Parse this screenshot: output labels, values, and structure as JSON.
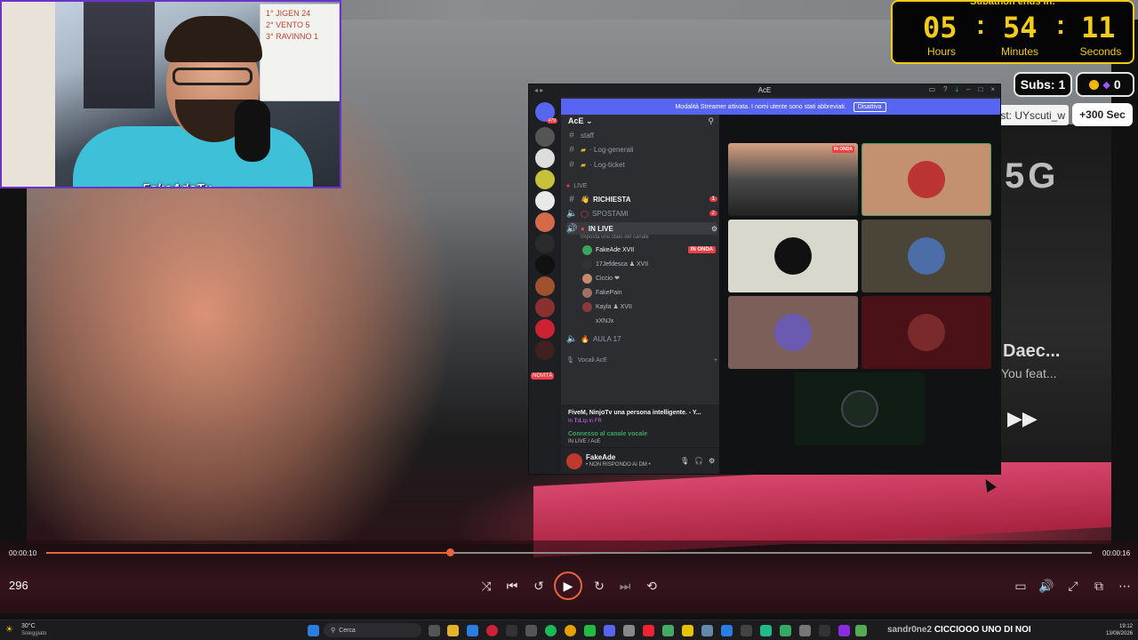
{
  "webcam": {
    "name_tag": "FakeAdeTv",
    "board_lines": [
      "1° JIGEN 24",
      "2° VENTO 5",
      "3° RAVINNO 1"
    ]
  },
  "timer": {
    "title": "Subathon ends in:",
    "hours": "05",
    "minutes": "54",
    "seconds": "11",
    "hours_label": "Hours",
    "minutes_label": "Minutes",
    "seconds_label": "Seconds"
  },
  "stats": {
    "subs": "Subs: 1",
    "bits": "0",
    "latest": "Latest: UYscuti_w",
    "time_add": "+300 Sec"
  },
  "discord": {
    "window_title": "AcE",
    "banner_text": "Modalità Streamer attivata. I nomi utente sono stati abbreviati.",
    "banner_button": "Disattiva",
    "server_name": "AcE",
    "server_badge_top": "479",
    "novita": "NOVITÀ",
    "channels": [
      {
        "name": "staff",
        "badge": ""
      },
      {
        "name": "· Log-generali",
        "badge": ""
      },
      {
        "name": "· Log-ticket",
        "badge": ""
      }
    ],
    "live_header": "LIVE",
    "live_channels": [
      {
        "name": "RICHIESTA",
        "badge": "1"
      },
      {
        "name": "SPOSTAMI",
        "badge": "2"
      }
    ],
    "voice_channel": "IN LIVE",
    "voice_channel_sub": "Imposta uno stato del canale",
    "users": [
      {
        "name": "FakeAde XVII",
        "tag": "IN ONDA"
      },
      {
        "name": "17Jefdesca ♟ XVII",
        "tag": ""
      },
      {
        "name": "Ciccio ❤",
        "tag": ""
      },
      {
        "name": "FakePain",
        "tag": ""
      },
      {
        "name": "Kayla ♟ XVII",
        "tag": ""
      },
      {
        "name": "xXNJx",
        "tag": ""
      }
    ],
    "aula": "AULA 17",
    "vocali_header": "Vocali AcE",
    "activity_title": "FiveM, NinjoTv una persona intelligente. - Y...",
    "activity_sub": "In 𝐓ɪ𝐋ɪp in FR",
    "voice_connected": "Connesso al canale vocale",
    "voice_connected_sub": "IN LIVE / AcE",
    "self_user": "FakeAde",
    "self_status": "• NON RISPONDO AI DM •",
    "in_onda_tag": "IN ONDA"
  },
  "player": {
    "current_time": "00:00:10",
    "total_time": "00:00:16",
    "progress": 0.386,
    "counter": "296"
  },
  "taskbar": {
    "weather_temp": "30°C",
    "weather_desc": "Soleggiato",
    "search_placeholder": "Cerca",
    "ticker_user": "sandr0ne2",
    "ticker_text": "CICCIOOO UNO DI NOI",
    "clock_time": "19:12",
    "clock_date": "13/08/2026"
  },
  "background": {
    "top_text": "Daec...",
    "sub_text": "You feat..."
  },
  "colors": {
    "timer": "#f2cc1d",
    "discord_blurple": "#5865f2",
    "progress": "#e8643a",
    "live_red": "#f23f43"
  }
}
